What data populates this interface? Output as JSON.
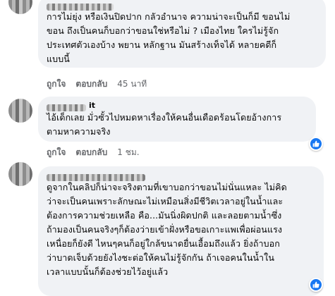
{
  "comments": [
    {
      "author_suffix": "",
      "lines": [
        "การไม่ยุ่ง หรือเงินปิดปาก กลัวอำนาจ ความน่าจะเป็นก็มี ขอนไม่",
        "ขอน ถึงเป็นคนก็บอกว่าขอนใช่หรือไม่ ? เมืองไทย ใครไม่รู้จัก",
        "ประเทศตัวเองบ้าง พยาน หลักฐาน มันสร้างเท็จได้ หลายคดีก็",
        "แบบนี้"
      ],
      "actions": {
        "like": "ถูกใจ",
        "reply": "ตอบกลับ",
        "time": "45 นาที"
      }
    },
    {
      "author_suffix": "it",
      "lines": [
        "ไอ้เด็กเลย มั่วซั้วไปหมดหาเรื่องให้คนอื่นเดือดร้อนโดยอ้างการ",
        "ตามหาความจริง"
      ],
      "actions": {
        "like": "ถูกใจ",
        "reply": "ตอบกลับ",
        "time": "1 ชม."
      },
      "reaction": "like-icon"
    },
    {
      "author_suffix": "",
      "lines": [
        "ดูจากในคลิปก็น่าจะจริงตามที่เขาบอกว่าขอนไม่นั่นแหละ ไม่คิด",
        "ว่าจะเป็นคนเพราะลักษณะไม่เหมือนสิ่งมีชีวิตเวลาอยู่ในน้ำและ",
        "ต้องการความช่วยเหลือ คือ...มันนิ่งผิดปกติ และลอยตามน้ำซึ่ง",
        "ถ้ามองเป็นคนจริงๆก็ต้องว่ายเข้าฝั่งหรือขอเกาะแพเพื่อผ่อนแรง",
        "เหนื่อยก็ยังดี ไหนๆคนก็อยู่ใกล้ขนาดยื่นเอื้อมถึงแล้ว ยิ่งถ้าบอก",
        "ว่าบาดเจ็บด้วยยังไงชะต่อให้คนไม่รู้จักกัน ถ้าเจอคนในน้ำใน",
        "เวลาแบบนั้นก็ต้องช่วยไว้อยู่แล้ว"
      ],
      "reaction": "like-icon"
    }
  ]
}
